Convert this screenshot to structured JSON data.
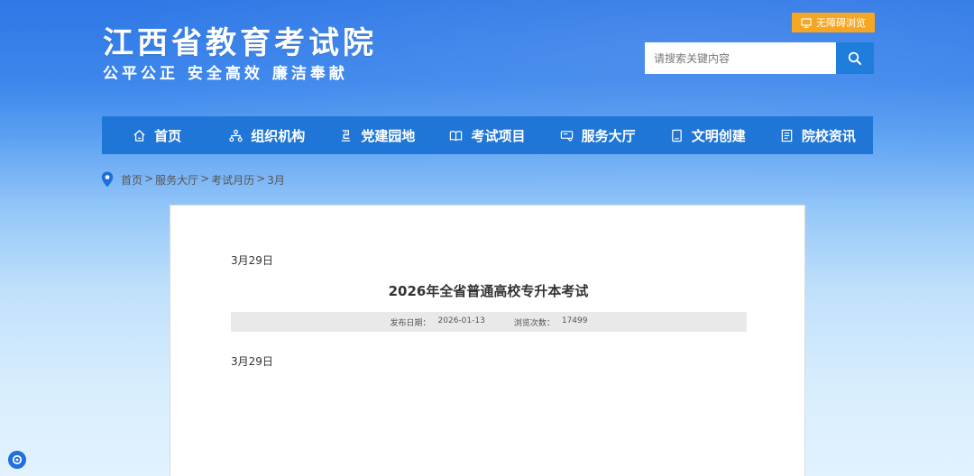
{
  "header": {
    "site_title": "江西省教育考试院",
    "slogan": "公平公正  安全高效  廉洁奉献",
    "accessibility_label": "无障碍浏览",
    "search_placeholder": "请搜索关键内容"
  },
  "nav": {
    "items": [
      {
        "label": "首页",
        "icon": "home-icon"
      },
      {
        "label": "组织机构",
        "icon": "org-chart-icon"
      },
      {
        "label": "党建园地",
        "icon": "party-building-icon"
      },
      {
        "label": "考试项目",
        "icon": "book-icon"
      },
      {
        "label": "服务大厅",
        "icon": "service-hall-icon"
      },
      {
        "label": "文明创建",
        "icon": "civilization-icon"
      },
      {
        "label": "院校资讯",
        "icon": "news-icon"
      }
    ]
  },
  "breadcrumb": {
    "items": [
      "首页",
      "服务大厅",
      "考试月历",
      "3月"
    ]
  },
  "article": {
    "pre_date": "3月29日",
    "title": "2026年全省普通高校专升本考试",
    "publish_label": "发布日期：",
    "publish_date": "2026-01-13",
    "views_label": "浏览次数：",
    "views": "17499",
    "body": "3月29日"
  },
  "colors": {
    "nav_bg": "#1f76d6",
    "access_btn": "#f5a623",
    "search_btn": "#1f7ddb"
  }
}
